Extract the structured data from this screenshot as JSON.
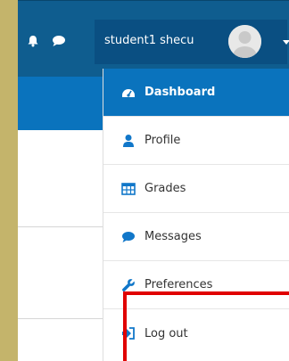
{
  "navbar": {
    "user_name": "student1 shecu",
    "icons": [
      "bell-icon",
      "chat-icon",
      "avatar",
      "chevron-down-icon"
    ]
  },
  "user_menu": {
    "items": [
      {
        "label": "Dashboard",
        "icon": "dashboard-icon",
        "active": true
      },
      {
        "label": "Profile",
        "icon": "user-icon",
        "active": false
      },
      {
        "label": "Grades",
        "icon": "table-icon",
        "active": false
      },
      {
        "label": "Messages",
        "icon": "chat-icon",
        "active": false
      },
      {
        "label": "Preferences",
        "icon": "wrench-icon",
        "active": false
      },
      {
        "label": "Log out",
        "icon": "logout-icon",
        "active": false
      }
    ]
  },
  "colors": {
    "navbar": "#0f5d8f",
    "active_item": "#0a73bd",
    "highlight_border": "#e00000",
    "frame": "#c4b46b"
  }
}
